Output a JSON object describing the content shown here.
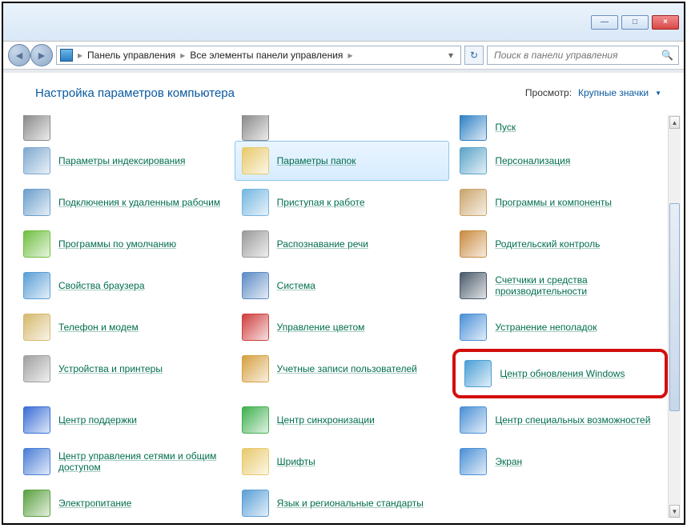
{
  "window": {
    "minimize": "—",
    "maximize": "□",
    "close": "×"
  },
  "breadcrumb": {
    "items": [
      "Панель управления",
      "Все элементы панели управления"
    ],
    "sep": "▸"
  },
  "search": {
    "placeholder": "Поиск в панели управления"
  },
  "header": {
    "title": "Настройка параметров компьютера",
    "view_label": "Просмотр:",
    "view_value": "Крупные значки"
  },
  "items": [
    [
      {
        "label": "",
        "icon": "#888",
        "name": "truncated-item-1"
      },
      {
        "label": "",
        "icon": "#888",
        "name": "truncated-item-2"
      },
      {
        "label": "Пуск",
        "icon": "#2a7ec2",
        "name": "item-start"
      }
    ],
    [
      {
        "label": "Параметры индексирования",
        "icon": "#7fa9d0",
        "name": "item-indexing-options"
      },
      {
        "label": "Параметры папок",
        "icon": "#e8c96b",
        "name": "item-folder-options",
        "selected": true
      },
      {
        "label": "Персонализация",
        "icon": "#5aa3c9",
        "name": "item-personalization"
      }
    ],
    [
      {
        "label": "Подключения к удаленным рабочим",
        "icon": "#6b9ecc",
        "name": "item-remote-desktop"
      },
      {
        "label": "Приступая к работе",
        "icon": "#74b6e0",
        "name": "item-getting-started"
      },
      {
        "label": "Программы и компоненты",
        "icon": "#caa46b",
        "name": "item-programs-features"
      }
    ],
    [
      {
        "label": "Программы по умолчанию",
        "icon": "#6fbf3f",
        "name": "item-default-programs"
      },
      {
        "label": "Распознавание речи",
        "icon": "#9a9a9a",
        "name": "item-speech-recognition"
      },
      {
        "label": "Родительский контроль",
        "icon": "#c98a3e",
        "name": "item-parental-controls"
      }
    ],
    [
      {
        "label": "Свойства браузера",
        "icon": "#5a9ed6",
        "name": "item-internet-options"
      },
      {
        "label": "Система",
        "icon": "#5c8bc4",
        "name": "item-system"
      },
      {
        "label": "Счетчики и средства производительности",
        "icon": "#4a5a6a",
        "name": "item-performance"
      }
    ],
    [
      {
        "label": "Телефон и модем",
        "icon": "#d6b96e",
        "name": "item-phone-modem"
      },
      {
        "label": "Управление цветом",
        "icon": "#cf3f3f",
        "name": "item-color-management"
      },
      {
        "label": "Устранение неполадок",
        "icon": "#4a90d6",
        "name": "item-troubleshooting"
      }
    ],
    [
      {
        "label": "Устройства и принтеры",
        "icon": "#a0a0a0",
        "name": "item-devices-printers"
      },
      {
        "label": "Учетные записи пользователей",
        "icon": "#d6a040",
        "name": "item-user-accounts"
      },
      {
        "label": "Центр обновления Windows",
        "icon": "#4a9fd6",
        "name": "item-windows-update",
        "highlight": true
      }
    ],
    [
      {
        "label": "Центр поддержки",
        "icon": "#3a6ed6",
        "name": "item-action-center"
      },
      {
        "label": "Центр синхронизации",
        "icon": "#3fb04f",
        "name": "item-sync-center"
      },
      {
        "label": "Центр специальных возможностей",
        "icon": "#4a90d6",
        "name": "item-ease-of-access"
      }
    ],
    [
      {
        "label": "Центр управления сетями и общим доступом",
        "icon": "#4a7ed6",
        "name": "item-network-sharing"
      },
      {
        "label": "Шрифты",
        "icon": "#e8c96b",
        "name": "item-fonts"
      },
      {
        "label": "Экран",
        "icon": "#4a90d6",
        "name": "item-display"
      }
    ],
    [
      {
        "label": "Электропитание",
        "icon": "#5aa03f",
        "name": "item-power-options"
      },
      {
        "label": "Язык и региональные стандарты",
        "icon": "#5a9ed6",
        "name": "item-region-language"
      },
      null
    ]
  ]
}
